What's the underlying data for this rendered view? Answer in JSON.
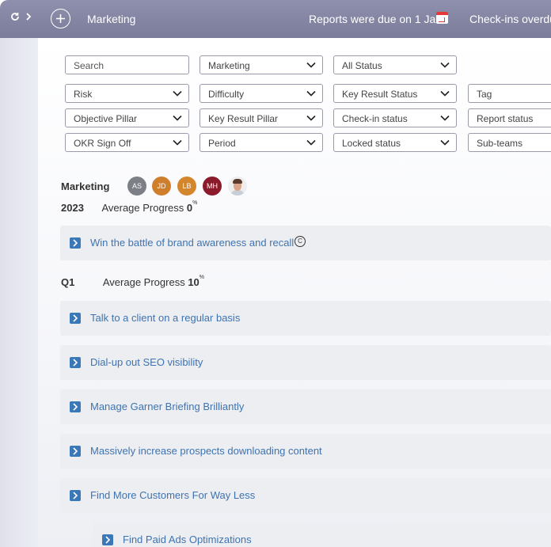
{
  "topbar": {
    "refresh_icon": "refresh-icon",
    "chevron_icon": "chevron-right-icon",
    "add_icon": "plus-circle-icon",
    "team_name": "Marketing",
    "due_notice": "Reports were due on 1 Jan",
    "calendar_icon": "calendar-icon",
    "checkins_notice": "Check-ins overdue"
  },
  "filters": {
    "search_placeholder": "Search",
    "team": "Marketing",
    "status": "All Status",
    "risk": "Risk",
    "difficulty": "Difficulty",
    "kr_status": "Key Result Status",
    "tag": "Tag",
    "objective_pillar": "Objective Pillar",
    "kr_pillar": "Key Result Pillar",
    "checkin_status": "Check-in status",
    "report_status": "Report status",
    "okr_signoff": "OKR Sign Off",
    "period": "Period",
    "locked_status": "Locked status",
    "subteams": "Sub-teams"
  },
  "team_section": {
    "name": "Marketing",
    "avatars": [
      {
        "initials": "AS",
        "color": "#7d7f86"
      },
      {
        "initials": "JD",
        "color": "#cf7e2b"
      },
      {
        "initials": "LB",
        "color": "#d4862c"
      },
      {
        "initials": "MH",
        "color": "#8b1a2b"
      }
    ]
  },
  "year_section": {
    "year": "2023",
    "avg_label": "Average Progress",
    "avg_value": "0",
    "avg_unit": "%",
    "objective": "Win the battle of brand awareness and recall"
  },
  "q1_section": {
    "label": "Q1",
    "avg_label": "Average Progress",
    "avg_value": "10",
    "avg_unit": "%",
    "objectives": [
      "Talk to a client on a regular basis",
      "Dial-up out SEO visibility",
      "Manage Garner Briefing Brilliantly",
      "Massively increase prospects downloading content",
      "Find More Customers For Way Less"
    ],
    "child_objective": "Find Paid Ads Optimizations"
  },
  "colors": {
    "topbar": "#8586a3",
    "link": "#3f73b0",
    "expand_button": "#3b78b8",
    "calendar_accent": "#e53935"
  }
}
